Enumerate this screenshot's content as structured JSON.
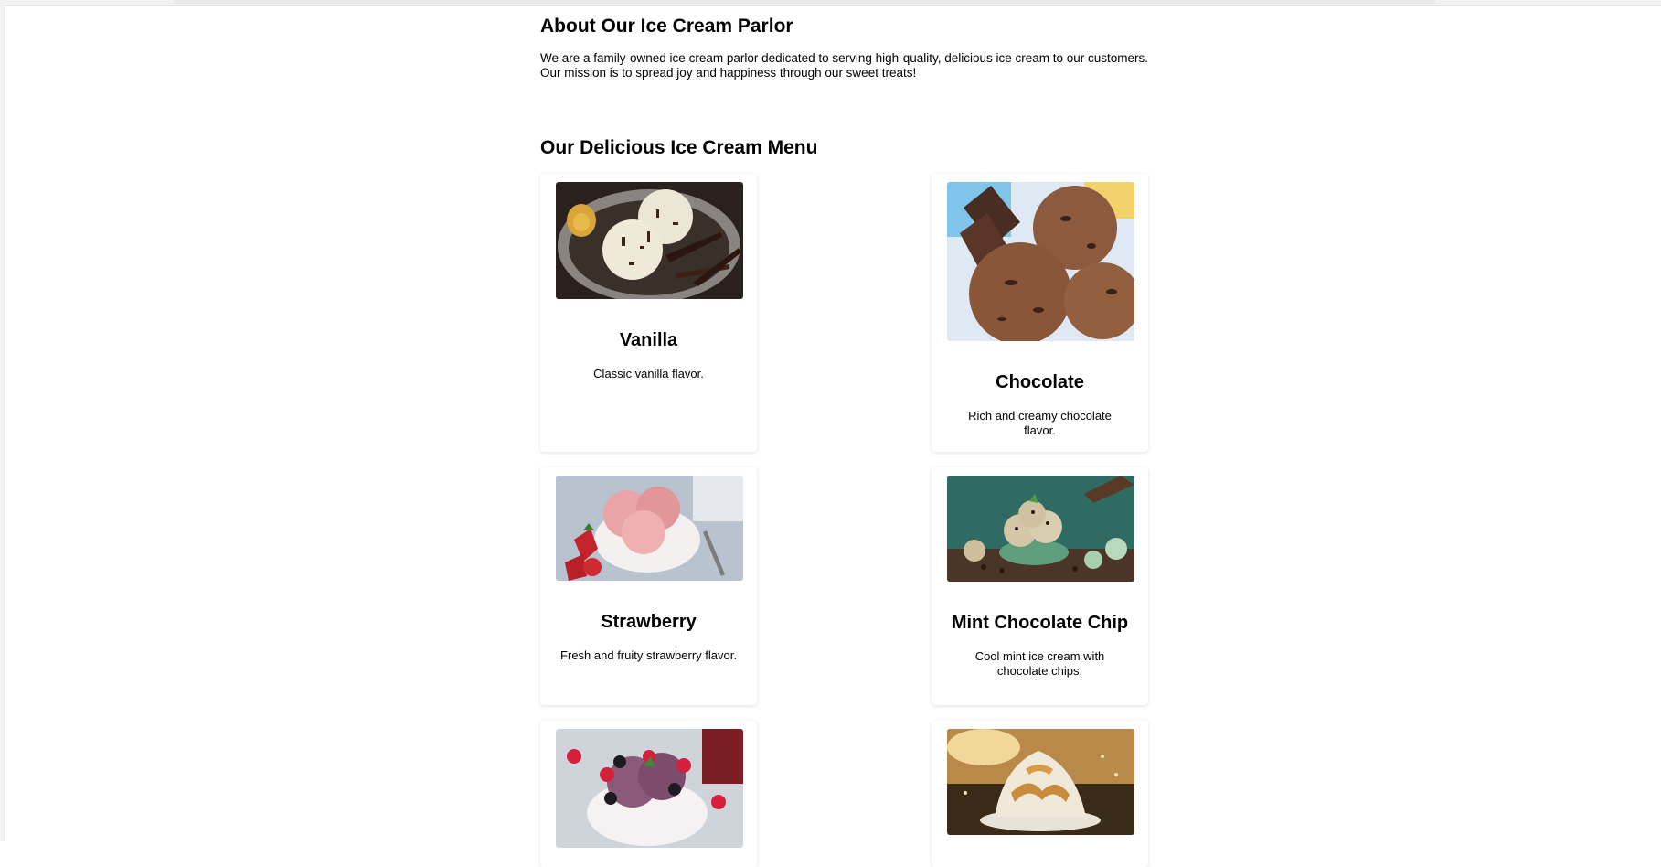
{
  "about": {
    "title": "About Our Ice Cream Parlor",
    "text_line1": "We are a family-owned ice cream parlor dedicated to serving high-quality, delicious ice cream to our customers.",
    "text_line2": "Our mission is to spread joy and happiness through our sweet treats!"
  },
  "menu": {
    "title": "Our Delicious Ice Cream Menu",
    "items": [
      {
        "name": "Vanilla",
        "description": "Classic vanilla flavor.",
        "image_icon": "vanilla-ice-cream-photo"
      },
      {
        "name": "Chocolate",
        "description": "Rich and creamy chocolate flavor.",
        "image_icon": "chocolate-ice-cream-photo"
      },
      {
        "name": "Strawberry",
        "description": "Fresh and fruity strawberry flavor.",
        "image_icon": "strawberry-ice-cream-photo"
      },
      {
        "name": "Mint Chocolate Chip",
        "description": "Cool mint ice cream with chocolate chips.",
        "image_icon": "mint-chocolate-chip-photo"
      },
      {
        "name": "",
        "description": "",
        "image_icon": "berry-ice-cream-photo"
      },
      {
        "name": "",
        "description": "",
        "image_icon": "caramel-sundae-photo"
      }
    ]
  },
  "colors": {
    "background": "#ffffff",
    "text": "#000000",
    "card_shadow": "#e0e0e0"
  }
}
